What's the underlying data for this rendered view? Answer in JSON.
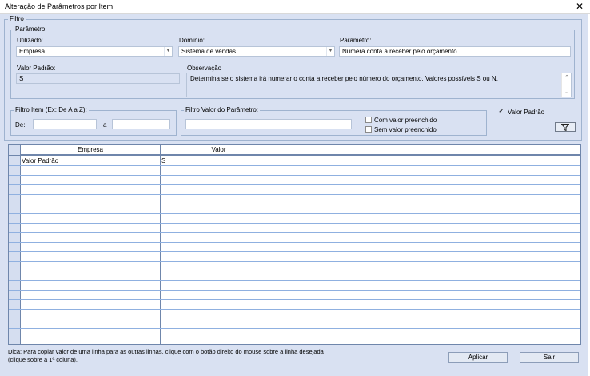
{
  "window": {
    "title": "Alteração de Parâmetros por Item",
    "close_glyph": "✕"
  },
  "filtro": {
    "legend": "Filtro",
    "parametro_group": {
      "legend": "Parâmetro",
      "utilizado_label": "Utilizado:",
      "utilizado_value": "Empresa",
      "dominio_label": "Domínio:",
      "dominio_value": "Sistema de vendas",
      "parametro_label": "Parâmetro:",
      "parametro_value": "Numera conta a receber pelo orçamento.",
      "valor_padrao_label": "Valor Padrão:",
      "valor_padrao_value": "S",
      "observacao_label": "Observação",
      "observacao_text": "Determina se o sistema irá numerar o conta a receber pelo número do orçamento. Valores possíveis S ou N."
    },
    "filtro_item": {
      "legend": "Filtro Item (Ex: De A a Z):",
      "de_label": "De:",
      "de_value": "",
      "a_label": "a",
      "a_value": ""
    },
    "filtro_valor": {
      "legend": "Filtro Valor do Parâmetro:",
      "value": "",
      "com_valor_label": "Com valor preenchido",
      "com_valor_checked": false,
      "sem_valor_label": "Sem valor preenchido",
      "sem_valor_checked": false
    },
    "valor_padrao_check_label": "Valor Padrão",
    "valor_padrao_checked": true,
    "filter_button_icon": "filter-funnel-icon"
  },
  "grid": {
    "columns": [
      "Empresa",
      "Valor"
    ],
    "rows": [
      [
        "Valor Padrão",
        "S"
      ]
    ]
  },
  "footer": {
    "hint": "Dica: Para copiar valor de uma linha para as outras linhas, clique com o botão direito do mouse sobre a linha desejada (clique sobre a 1ª coluna).",
    "apply_label": "Aplicar",
    "exit_label": "Sair"
  }
}
